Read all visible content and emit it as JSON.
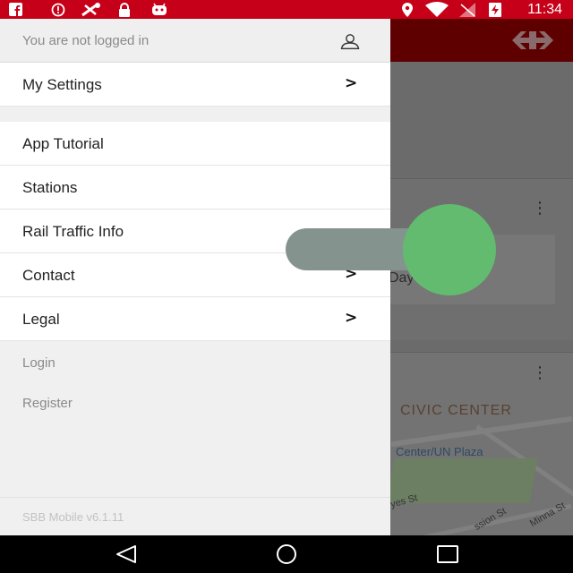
{
  "status_bar": {
    "time": "11:34",
    "left_icons": [
      "facebook-icon",
      "alert-icon",
      "no-signal-tool-icon",
      "lock-icon",
      "android-icon"
    ],
    "right_icons": [
      "location-icon",
      "wifi-icon",
      "no-sim-icon",
      "battery-charging-icon"
    ]
  },
  "drawer": {
    "header_text": "You are not logged in",
    "items": [
      {
        "label": "My Settings",
        "chevron": ">"
      },
      {
        "label": "App Tutorial",
        "chevron": ""
      },
      {
        "label": "Stations",
        "chevron": ""
      },
      {
        "label": "Rail Traffic Info",
        "chevron": ""
      },
      {
        "label": "Contact",
        "chevron": ">"
      },
      {
        "label": "Legal",
        "chevron": ">"
      }
    ],
    "links": [
      {
        "label": "Login"
      },
      {
        "label": "Register"
      }
    ],
    "version": "SBB Mobile v6.1.11"
  },
  "background": {
    "header_color": "#5e0000",
    "card1": {
      "button_label": "Day Pass"
    },
    "map": {
      "district": "CIVIC CENTER",
      "station": "Center/UN Plaza",
      "streets": [
        "yes St",
        "ssion St",
        "Minna St"
      ]
    }
  },
  "overlay_toggle": {
    "track_color": "#85938f",
    "knob_color": "#62bb6f"
  },
  "nav_bar": {
    "buttons": [
      "back",
      "home",
      "recents"
    ]
  },
  "colors": {
    "brand_red": "#c60018"
  }
}
